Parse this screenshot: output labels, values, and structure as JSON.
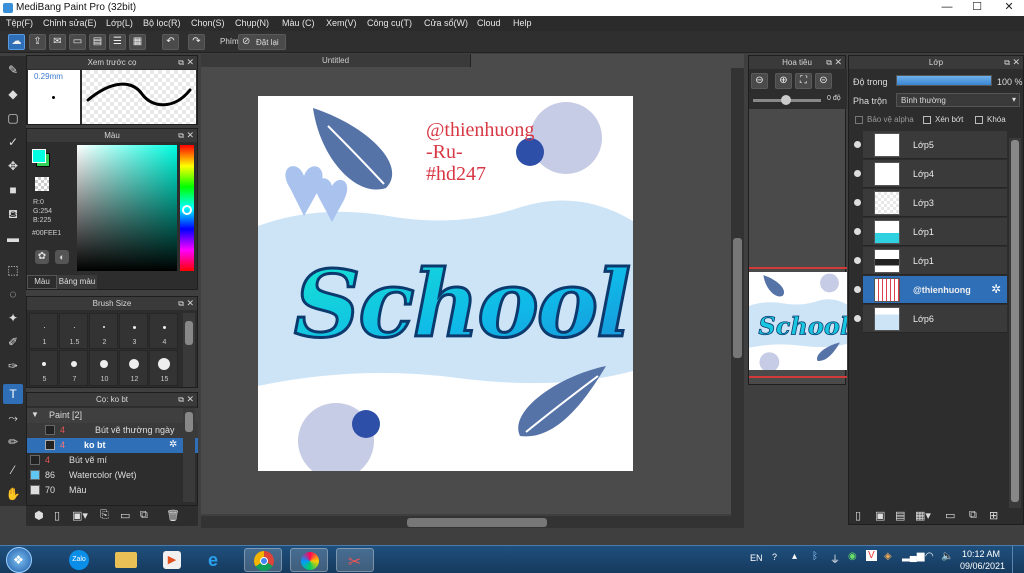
{
  "window": {
    "title": "MediBang Paint Pro (32bit)"
  },
  "menu": [
    "Tệp(F)",
    "Chỉnh sửa(E)",
    "Lớp(L)",
    "Bộ lọc(R)",
    "Chọn(S)",
    "Chụp(N)",
    "Màu (C)",
    "Xem(V)",
    "Công cụ(T)",
    "Cửa sổ(W)",
    "Cloud",
    "Help"
  ],
  "toolbar": {
    "phim_label": "Phím",
    "reset_label": "Đặt lại"
  },
  "brush_preview": {
    "title": "Xem trước cọ",
    "size": "0.29mm"
  },
  "color_panel": {
    "title": "Màu",
    "r": "R:0",
    "g": "G:254",
    "b": "B:225",
    "hex": "#00FEE1",
    "tab_color": "Màu",
    "tab_palette": "Bảng màu",
    "primary_color": "#00FEE1",
    "secondary_color": "#33D05A"
  },
  "brush_size": {
    "title": "Brush Size",
    "sizes": [
      "1",
      "1.5",
      "2",
      "3",
      "4",
      "5",
      "7",
      "10",
      "12",
      "15"
    ]
  },
  "brush_list": {
    "title": "Cọ: ko bt",
    "group": "Paint [2]",
    "items": [
      {
        "num": "4",
        "name": "Bút vẽ thường ngày"
      },
      {
        "num": "4",
        "name": "ko bt"
      },
      {
        "num": "4",
        "name": "Bút vẽ mí"
      },
      {
        "num": "86",
        "name": "Watercolor (Wet)"
      },
      {
        "num": "70",
        "name": "Màu"
      }
    ]
  },
  "canvas": {
    "doc_title": "Untitled",
    "watermark_lines": [
      "@thienhuong",
      "-Ru-",
      "#hd247"
    ],
    "artwork_text": "School"
  },
  "navigator": {
    "title": "Hoa tiêu",
    "angle": "0 độ"
  },
  "layers_panel": {
    "title": "Lớp",
    "opacity_label": "Độ trong",
    "opacity_value": "100 %",
    "opacity_fraction": 1.0,
    "blend_label": "Pha trộn",
    "blend_value": "Bình thường",
    "protect_alpha": "Bảo vệ alpha",
    "clipping": "Xén bớt",
    "lock": "Khóa",
    "layers": [
      {
        "name": "Lớp5",
        "selected": false
      },
      {
        "name": "Lớp4",
        "selected": false
      },
      {
        "name": "Lớp3",
        "selected": false
      },
      {
        "name": "Lớp1",
        "selected": false
      },
      {
        "name": "Lớp1",
        "selected": false
      },
      {
        "name": "@thienhuong",
        "selected": true
      },
      {
        "name": "Lớp6",
        "selected": false
      }
    ]
  },
  "taskbar": {
    "lang": "EN",
    "time": "10:12 AM",
    "date": "09/06/2021",
    "apps": [
      "Zalo"
    ]
  },
  "colors": {
    "accent": "#2F6FB8",
    "leaf": "#5673A8",
    "bubble": "#C7CCE6"
  }
}
